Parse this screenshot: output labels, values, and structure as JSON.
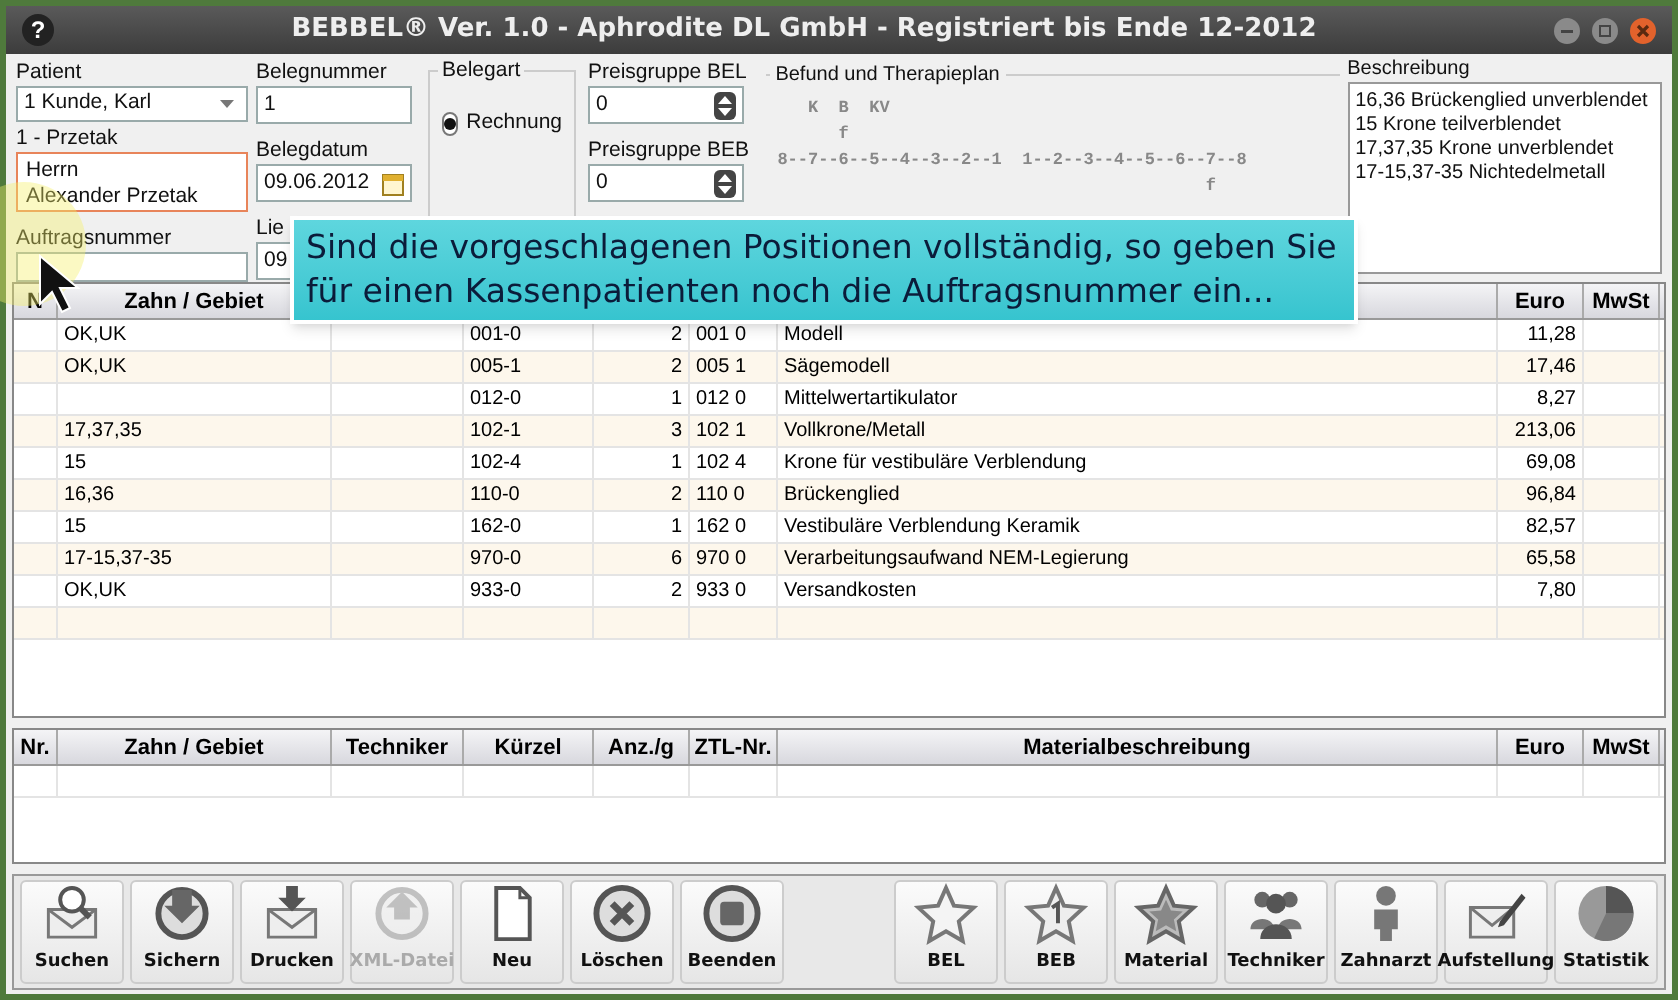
{
  "window": {
    "title": "BEBBEL® Ver. 1.0 - Aphrodite DL GmbH - Registriert bis Ende  12-2012",
    "help": "?"
  },
  "form": {
    "patient": {
      "label": "Patient",
      "value": "1 Kunde, Karl"
    },
    "patient_short": "1 - Przetak",
    "address": [
      "Herrn",
      "Alexander Przetak"
    ],
    "auftragsnummer": {
      "label": "Auftragsnummer"
    },
    "belegnummer": {
      "label": "Belegnummer",
      "value": "1"
    },
    "belegdatum": {
      "label": "Belegdatum",
      "value": "09.06.2012"
    },
    "lieferdatum": {
      "label": "Lie",
      "value": "09"
    },
    "belegart": {
      "label": "Belegart",
      "options": [
        {
          "label": "Rechnung",
          "selected": true
        }
      ]
    },
    "preisgruppe_bel": {
      "label": "Preisgruppe BEL",
      "value": "0"
    },
    "preisgruppe_beb": {
      "label": "Preisgruppe BEB",
      "value": "0"
    },
    "befund": {
      "label": "Befund und Therapieplan",
      "lines": [
        "   K  B  KV",
        "      f",
        "8--7--6--5--4--3--2--1  1--2--3--4--5--6--7--8",
        "                                          f"
      ]
    },
    "beschreibung": {
      "label": "Beschreibung",
      "lines": [
        "16,36 Brückenglied unverblendet",
        "15 Krone teilverblendet",
        "17,37,35 Krone unverblendet",
        "17-15,37-35 Nichtedelmetall"
      ]
    }
  },
  "tooltip": "Sind die vorgeschlagenen Positionen vollständig, so geben Sie für einen Kassenpatienten noch die Auftragsnummer ein...",
  "positions": {
    "columns": [
      "N",
      "Zahn / Gebiet",
      "",
      "",
      "",
      "",
      "",
      "Euro",
      "MwSt"
    ],
    "rows": [
      [
        "",
        "OK,UK",
        "",
        "001-0",
        "2",
        "001 0",
        "Modell",
        "11,28",
        ""
      ],
      [
        "",
        "OK,UK",
        "",
        "005-1",
        "2",
        "005 1",
        "Sägemodell",
        "17,46",
        ""
      ],
      [
        "",
        "",
        "",
        "012-0",
        "1",
        "012 0",
        "Mittelwertartikulator",
        "8,27",
        ""
      ],
      [
        "",
        "17,37,35",
        "",
        "102-1",
        "3",
        "102 1",
        "Vollkrone/Metall",
        "213,06",
        ""
      ],
      [
        "",
        "15",
        "",
        "102-4",
        "1",
        "102 4",
        "Krone für vestibuläre Verblendung",
        "69,08",
        ""
      ],
      [
        "",
        "16,36",
        "",
        "110-0",
        "2",
        "110 0",
        "Brückenglied",
        "96,84",
        ""
      ],
      [
        "",
        "15",
        "",
        "162-0",
        "1",
        "162 0",
        "Vestibuläre Verblendung Keramik",
        "82,57",
        ""
      ],
      [
        "",
        "17-15,37-35",
        "",
        "970-0",
        "6",
        "970 0",
        "Verarbeitungsaufwand NEM-Legierung",
        "65,58",
        ""
      ],
      [
        "",
        "OK,UK",
        "",
        "933-0",
        "2",
        "933 0",
        "Versandkosten",
        "7,80",
        ""
      ]
    ]
  },
  "materials": {
    "columns": [
      "Nr.",
      "Zahn / Gebiet",
      "Techniker",
      "Kürzel",
      "Anz./g",
      "ZTL-Nr.",
      "Materialbeschreibung",
      "Euro",
      "MwSt"
    ]
  },
  "toolbar_left": [
    {
      "label": "Suchen",
      "disabled": false
    },
    {
      "label": "Sichern",
      "disabled": false
    },
    {
      "label": "Drucken",
      "disabled": false
    },
    {
      "label": "XML-Datei",
      "disabled": true
    },
    {
      "label": "Neu",
      "disabled": false
    },
    {
      "label": "Löschen",
      "disabled": false
    },
    {
      "label": "Beenden",
      "disabled": false
    }
  ],
  "toolbar_right": [
    {
      "label": "BEL",
      "disabled": false
    },
    {
      "label": "BEB",
      "disabled": false
    },
    {
      "label": "Material",
      "disabled": false
    },
    {
      "label": "Techniker",
      "disabled": false
    },
    {
      "label": "Zahnarzt",
      "disabled": false
    },
    {
      "label": "Aufstellung",
      "disabled": false
    },
    {
      "label": "Statistik",
      "disabled": false
    }
  ]
}
